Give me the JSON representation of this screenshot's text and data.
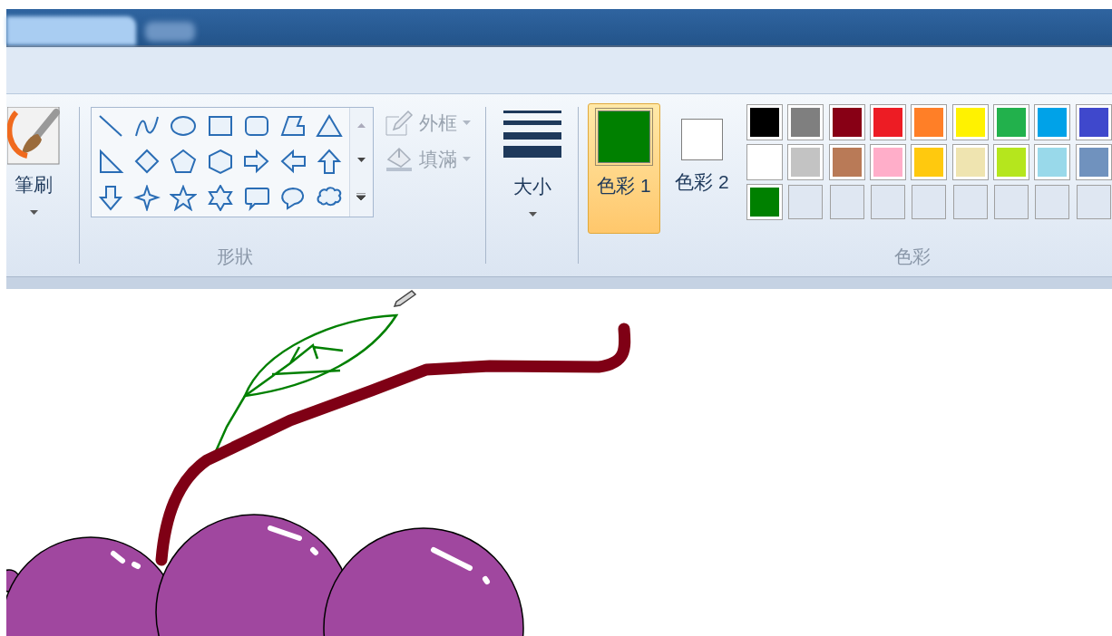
{
  "ribbon": {
    "brush": {
      "label": "筆刷"
    },
    "shapes_group": {
      "label": "形狀"
    },
    "outline": {
      "label": "外框",
      "disabled": true
    },
    "fill": {
      "label": "填滿",
      "disabled": true
    },
    "size": {
      "label": "大小"
    },
    "color_buttons": [
      {
        "label": "色彩 1",
        "selected": true,
        "color": "#008000"
      },
      {
        "label": "色彩 2",
        "selected": false,
        "color": "#ffffff"
      }
    ],
    "palette": [
      {
        "kind": "swatch",
        "color": "#000000"
      },
      {
        "kind": "swatch",
        "color": "#7f7f7f"
      },
      {
        "kind": "swatch",
        "color": "#880015"
      },
      {
        "kind": "swatch",
        "color": "#ed1c24"
      },
      {
        "kind": "swatch",
        "color": "#ff7f27"
      },
      {
        "kind": "swatch",
        "color": "#fff200"
      },
      {
        "kind": "swatch",
        "color": "#22b14c"
      },
      {
        "kind": "swatch",
        "color": "#00a2e8"
      },
      {
        "kind": "swatch",
        "color": "#3f48cc"
      },
      {
        "kind": "swatch",
        "color": "#ffffff"
      },
      {
        "kind": "swatch",
        "color": "#c3c3c3"
      },
      {
        "kind": "swatch",
        "color": "#b97a57"
      },
      {
        "kind": "swatch",
        "color": "#ffaec9"
      },
      {
        "kind": "swatch",
        "color": "#ffc90e"
      },
      {
        "kind": "swatch",
        "color": "#efe4b0"
      },
      {
        "kind": "swatch",
        "color": "#b5e61d"
      },
      {
        "kind": "swatch",
        "color": "#99d9ea"
      },
      {
        "kind": "swatch",
        "color": "#7092be"
      },
      {
        "kind": "swatch",
        "color": "#008000"
      },
      {
        "kind": "empty"
      },
      {
        "kind": "empty"
      },
      {
        "kind": "empty"
      },
      {
        "kind": "empty"
      },
      {
        "kind": "empty"
      },
      {
        "kind": "empty"
      },
      {
        "kind": "empty"
      },
      {
        "kind": "empty"
      }
    ],
    "colors_group": {
      "label": "色彩"
    }
  }
}
